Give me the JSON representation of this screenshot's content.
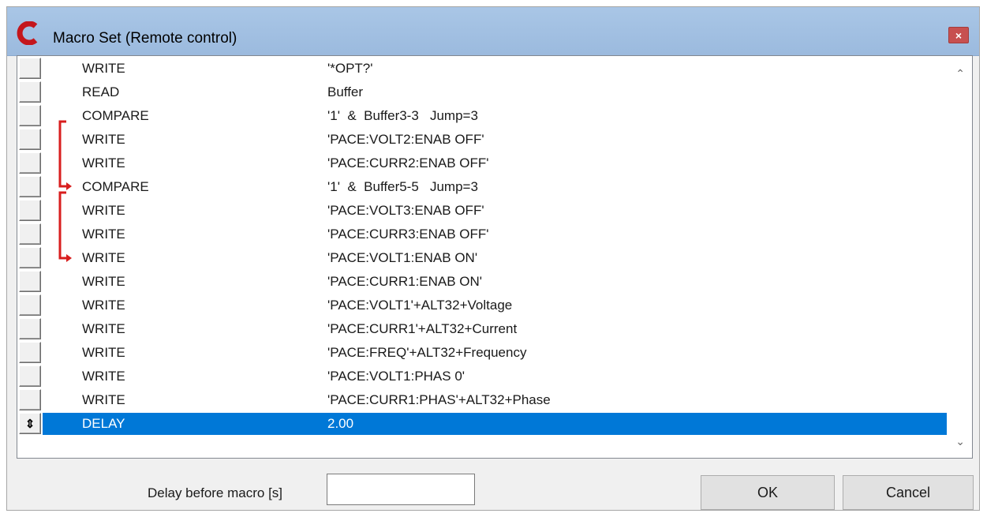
{
  "window": {
    "title": "Macro Set (Remote control)",
    "close_label": "×"
  },
  "macro": {
    "rows": [
      {
        "cmd": "WRITE",
        "arg": "'*OPT?'"
      },
      {
        "cmd": "READ",
        "arg": "Buffer"
      },
      {
        "cmd": "COMPARE",
        "arg": "'1'  &  Buffer3-3   Jump=3"
      },
      {
        "cmd": "WRITE",
        "arg": "'PACE:VOLT2:ENAB OFF'"
      },
      {
        "cmd": "WRITE",
        "arg": "'PACE:CURR2:ENAB OFF'"
      },
      {
        "cmd": "COMPARE",
        "arg": "'1'  &  Buffer5-5   Jump=3"
      },
      {
        "cmd": "WRITE",
        "arg": "'PACE:VOLT3:ENAB OFF'"
      },
      {
        "cmd": "WRITE",
        "arg": "'PACE:CURR3:ENAB OFF'"
      },
      {
        "cmd": "WRITE",
        "arg": "'PACE:VOLT1:ENAB ON'"
      },
      {
        "cmd": "WRITE",
        "arg": "'PACE:CURR1:ENAB ON'"
      },
      {
        "cmd": "WRITE",
        "arg": "'PACE:VOLT1'+ALT32+Voltage"
      },
      {
        "cmd": "WRITE",
        "arg": "'PACE:CURR1'+ALT32+Current"
      },
      {
        "cmd": "WRITE",
        "arg": "'PACE:FREQ'+ALT32+Frequency"
      },
      {
        "cmd": "WRITE",
        "arg": "'PACE:VOLT1:PHAS 0'"
      },
      {
        "cmd": "WRITE",
        "arg": "'PACE:CURR1:PHAS'+ALT32+Phase"
      },
      {
        "cmd": "DELAY",
        "arg": "2.00",
        "selected": true,
        "handle": "⇕"
      }
    ]
  },
  "delay": {
    "label": "Delay before macro [s]",
    "value": ""
  },
  "buttons": {
    "ok": "OK",
    "cancel": "Cancel"
  },
  "colors": {
    "selection": "#0078d7",
    "jump_arrow": "#d81e1e",
    "titlebar": "#a9c6e6",
    "close": "#c75050"
  }
}
